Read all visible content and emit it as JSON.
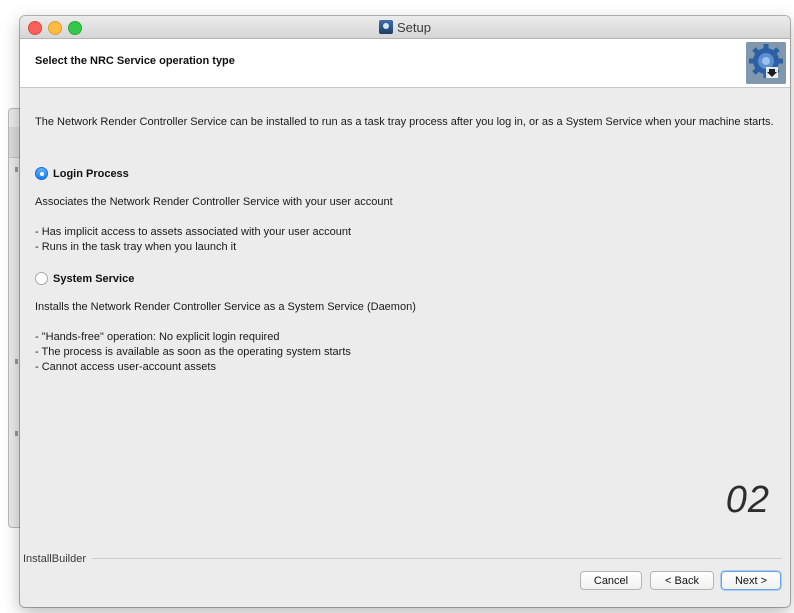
{
  "window": {
    "title": "Setup",
    "app_icon": "setup-app-icon"
  },
  "header": {
    "title": "Select the NRC Service operation type",
    "logo_icon": "gear-download-icon"
  },
  "content": {
    "intro": "The Network Render Controller Service can be installed to run as a task tray process after you log in, or as a System Service when your machine starts.",
    "options": [
      {
        "label": "Login Process",
        "selected": true,
        "description": "Associates the Network Render Controller Service with your user account",
        "bullets": [
          "- Has implicit access to assets associated with your user account",
          "- Runs in the task tray when you launch it"
        ]
      },
      {
        "label": "System Service",
        "selected": false,
        "description": "Installs the Network Render Controller Service as a System Service (Daemon)",
        "bullets": [
          "- \"Hands-free\" operation: No explicit login required",
          "- The process is available as soon as the operating system starts",
          "- Cannot access user-account assets"
        ]
      }
    ],
    "step_number": "02"
  },
  "footer": {
    "brand": "InstallBuilder",
    "cancel_label": "Cancel",
    "back_label": "< Back",
    "next_label": "Next >"
  },
  "colors": {
    "accent": "#1a82f7",
    "window_bg": "#ececec"
  }
}
